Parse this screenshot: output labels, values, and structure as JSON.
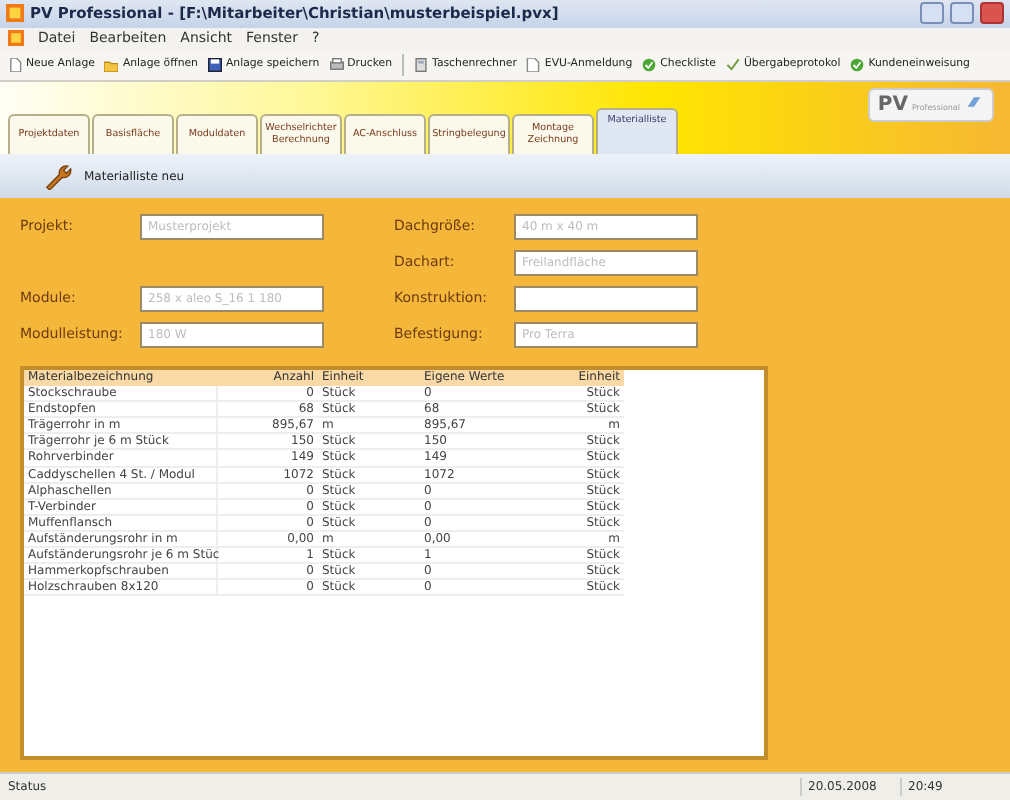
{
  "window": {
    "title": "PV Professional - [F:\\Mitarbeiter\\Christian\\musterbeispiel.pvx]"
  },
  "menu": [
    "Datei",
    "Bearbeiten",
    "Ansicht",
    "Fenster",
    "?"
  ],
  "toolbar": [
    {
      "label": "Neue Anlage"
    },
    {
      "label": "Anlage öffnen"
    },
    {
      "label": "Anlage speichern"
    },
    {
      "label": "Drucken"
    },
    {
      "label": "Taschenrechner"
    },
    {
      "label": "EVU-Anmeldung"
    },
    {
      "label": "Checkliste"
    },
    {
      "label": "Übergabeprotokol"
    },
    {
      "label": "Kundeneinweisung"
    }
  ],
  "logo": {
    "text": "PV",
    "subtext": "Professional"
  },
  "tabs": [
    {
      "label": "Projektdaten",
      "selected": false
    },
    {
      "label": "Basisfläche",
      "selected": false
    },
    {
      "label": "Moduldaten",
      "selected": false
    },
    {
      "label": "Wechselrichter Berechnung",
      "selected": false
    },
    {
      "label": "AC-Anschluss",
      "selected": false
    },
    {
      "label": "Stringbelegung",
      "selected": false
    },
    {
      "label": "Montage Zeichnung",
      "selected": false
    },
    {
      "label": "Materialliste",
      "selected": true
    }
  ],
  "action": {
    "label": "Materialliste neu"
  },
  "left_fields": [
    {
      "label": "Projekt:",
      "value": "Musterprojekt"
    },
    {
      "label": "Module:",
      "value": "258 x aleo S_16 1 180"
    },
    {
      "label": "Modulleistung:",
      "value": "180 W"
    }
  ],
  "right_fields": [
    {
      "label": "Dachgröße:",
      "value": "40 m x 40 m"
    },
    {
      "label": "Dachart:",
      "value": "Freilandfläche"
    },
    {
      "label": "Konstruktion:"
    },
    {
      "label": "Befestigung:",
      "value": "Pro Terra"
    }
  ],
  "table": {
    "columns": [
      "Materialbezeichnung",
      "Anzahl",
      "Einheit",
      "Eigene Werte",
      "Einheit"
    ],
    "rows": [
      [
        "Stockschraube",
        "0",
        "Stück",
        "0",
        "Stück"
      ],
      [
        "Endstopfen",
        "68",
        "Stück",
        "68",
        "Stück"
      ],
      [
        "Trägerrohr in m",
        "895,67",
        "m",
        "895,67",
        "m"
      ],
      [
        "Trägerrohr je 6 m Stück",
        "150",
        "Stück",
        "150",
        "Stück"
      ],
      [
        "Rohrverbinder",
        "149",
        "Stück",
        "149",
        "Stück"
      ],
      [
        "Caddyschellen 4 St. / Modul",
        "1072",
        "Stück",
        "1072",
        "Stück"
      ],
      [
        "Alphaschellen",
        "0",
        "Stück",
        "0",
        "Stück"
      ],
      [
        "T-Verbinder",
        "0",
        "Stück",
        "0",
        "Stück"
      ],
      [
        "Muffenflansch",
        "0",
        "Stück",
        "0",
        "Stück"
      ],
      [
        "Aufständerungsrohr in m",
        "0,00",
        "m",
        "0,00",
        "m"
      ],
      [
        "Aufständerungsrohr je 6 m Stüc",
        "1",
        "Stück",
        "1",
        "Stück"
      ],
      [
        "Hammerkopfschrauben",
        "0",
        "Stück",
        "0",
        "Stück"
      ],
      [
        "Holzschrauben 8x120",
        "0",
        "Stück",
        "0",
        "Stück"
      ]
    ]
  },
  "status_bar": [
    "Status",
    "20.05.2008",
    "20:49"
  ]
}
